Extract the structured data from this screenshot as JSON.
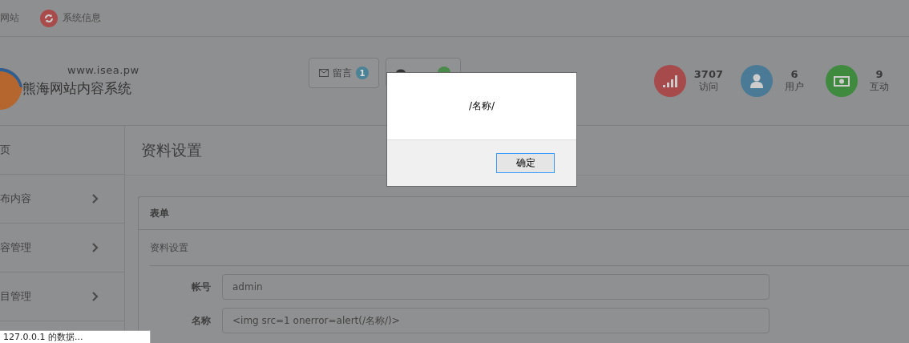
{
  "top_bar": {
    "links": [
      {
        "label": "网站",
        "kind": "plain"
      },
      {
        "label": "系统信息",
        "kind": "refresh"
      }
    ]
  },
  "header": {
    "site_url": "www.isea.pw",
    "site_name": "熊海网站内容系统",
    "buttons": [
      {
        "label": "留言",
        "count": "1",
        "kind": "mail",
        "color": "#4a8296"
      },
      {
        "kind": "comment",
        "color": "#4a8a4a"
      }
    ],
    "stats": [
      {
        "value": "3707",
        "label": "访问",
        "kind": "signal",
        "color": "#a64a4b"
      },
      {
        "value": "6",
        "label": "用户",
        "kind": "user",
        "color": "#4a7a96"
      },
      {
        "value": "9",
        "label": "互动",
        "kind": "money",
        "color": "#3f8a3f"
      }
    ]
  },
  "sidebar": {
    "items": [
      {
        "label": "页",
        "expandable": false
      },
      {
        "label": "布内容",
        "expandable": true
      },
      {
        "label": "容管理",
        "expandable": true
      },
      {
        "label": "目管理",
        "expandable": true
      }
    ]
  },
  "main": {
    "title": "资料设置",
    "panel": {
      "title": "表单",
      "section": "资料设置",
      "fields": [
        {
          "label": "帐号",
          "value": "admin"
        },
        {
          "label": "名称",
          "value": "<img src=1 onerror=alert(/名称/)>"
        }
      ]
    }
  },
  "dialog": {
    "message": "/名称/",
    "button": "确定"
  },
  "status_tooltip": "127.0.0.1 的数据..."
}
